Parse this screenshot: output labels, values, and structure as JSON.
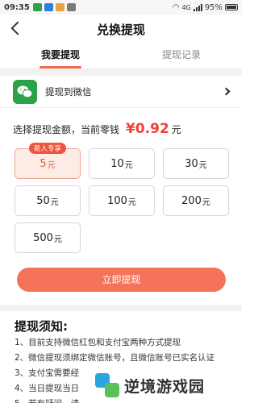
{
  "status_bar": {
    "time": "09:35",
    "battery": "95%",
    "signal": "4G"
  },
  "nav": {
    "title": "兑换提现"
  },
  "tabs": [
    {
      "label": "我要提现",
      "active": true
    },
    {
      "label": "提现记录",
      "active": false
    }
  ],
  "wechat": {
    "label": "提现到微信",
    "icon": "wechat-icon",
    "color": "#2ba247"
  },
  "balance": {
    "prefix": "选择提现金额，当前零钱",
    "amount": "¥0.92",
    "unit": "元"
  },
  "options": [
    {
      "value": "5",
      "unit": "元",
      "selected": true,
      "badge": "新人专享"
    },
    {
      "value": "10",
      "unit": "元",
      "selected": false
    },
    {
      "value": "30",
      "unit": "元",
      "selected": false
    },
    {
      "value": "50",
      "unit": "元",
      "selected": false
    },
    {
      "value": "100",
      "unit": "元",
      "selected": false
    },
    {
      "value": "200",
      "unit": "元",
      "selected": false
    },
    {
      "value": "500",
      "unit": "元",
      "selected": false
    }
  ],
  "submit": {
    "label": "立即提现",
    "color": "#f4735a"
  },
  "notice": {
    "title": "提现须知:",
    "items": [
      "1、目前支持微信红包和支付宝两种方式提现",
      "2、微信提现须绑定微信账号，且微信账号已实名认证",
      "3、支付宝需要经",
      "4、当日提现当日",
      "5、若有疑问，请"
    ]
  },
  "watermark": {
    "text": "逆境游戏园"
  },
  "colors": {
    "accent": "#f26a4b",
    "price": "#f2403a"
  }
}
